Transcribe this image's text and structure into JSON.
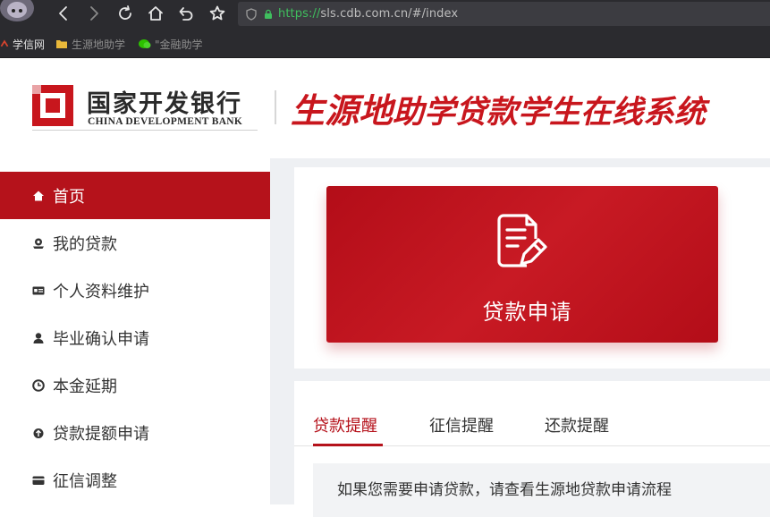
{
  "browser": {
    "url_scheme": "https://",
    "url_rest": "sls.cdb.com.cn/#/index",
    "bookmarks": [
      {
        "label": "学信网"
      },
      {
        "label": "生源地助学"
      },
      {
        "label": "\"金融助学"
      }
    ]
  },
  "header": {
    "logo_cn": "国家开发银行",
    "logo_en": "CHINA DEVELOPMENT BANK",
    "system_title_main": "生源地",
    "system_title_rest": "助学贷款学生在线系统"
  },
  "sidebar": {
    "items": [
      {
        "label": "首页",
        "icon": "home-icon"
      },
      {
        "label": "我的贷款",
        "icon": "loan-icon"
      },
      {
        "label": "个人资料维护",
        "icon": "id-card-icon"
      },
      {
        "label": "毕业确认申请",
        "icon": "graduate-icon"
      },
      {
        "label": "本金延期",
        "icon": "clock-icon"
      },
      {
        "label": "贷款提额申请",
        "icon": "upgrade-icon"
      },
      {
        "label": "征信调整",
        "icon": "card-icon"
      }
    ],
    "active_index": 0
  },
  "main": {
    "apply_button_label": "贷款申请",
    "tabs": [
      {
        "label": "贷款提醒"
      },
      {
        "label": "征信提醒"
      },
      {
        "label": "还款提醒"
      }
    ],
    "notice_text": "如果您需要申请贷款，请查看生源地贷款申请流程"
  },
  "colors": {
    "brand_red": "#b5121b",
    "link_green": "#3fbf5e"
  }
}
